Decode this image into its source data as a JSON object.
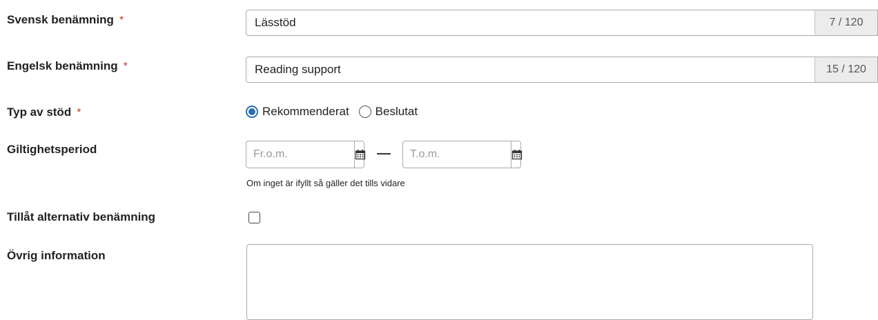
{
  "fields": {
    "swedish_name": {
      "label": "Svensk benämning",
      "required_mark": "*",
      "value": "Lässtöd",
      "counter": "7 / 120"
    },
    "english_name": {
      "label": "Engelsk benämning",
      "required_mark": "*",
      "value": "Reading support",
      "counter": "15 / 120"
    },
    "support_type": {
      "label": "Typ av stöd",
      "required_mark": "*",
      "options": [
        "Rekommenderat",
        "Beslutat"
      ],
      "selected": "Rekommenderat"
    },
    "validity_period": {
      "label": "Giltighetsperiod",
      "from_placeholder": "Fr.o.m.",
      "to_placeholder": "T.o.m.",
      "hint": "Om inget är ifyllt så gäller det tills vidare",
      "calendar_icon": "calendar-icon"
    },
    "allow_alt_name": {
      "label": "Tillåt alternativ benämning",
      "checked": false
    },
    "other_info": {
      "label": "Övrig information",
      "value": ""
    }
  },
  "colors": {
    "accent": "#2a6fb0",
    "required": "#c0392b",
    "border": "#a9a9a9",
    "counter_bg": "#ececec"
  }
}
